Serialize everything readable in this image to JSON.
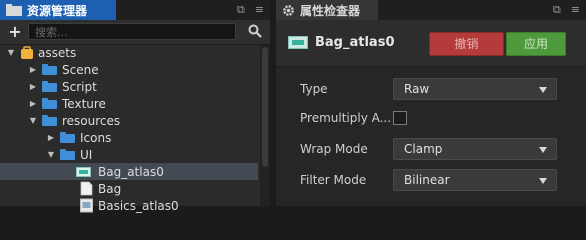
{
  "left_panel": {
    "title": "资源管理器",
    "search": {
      "placeholder": "搜索..."
    },
    "tree": [
      {
        "label": "assets",
        "level": 0,
        "expanded": true,
        "kind": "root"
      },
      {
        "label": "Scene",
        "level": 1,
        "expanded": false,
        "kind": "folder"
      },
      {
        "label": "Script",
        "level": 1,
        "expanded": false,
        "kind": "folder"
      },
      {
        "label": "Texture",
        "level": 1,
        "expanded": false,
        "kind": "folder"
      },
      {
        "label": "resources",
        "level": 1,
        "expanded": true,
        "kind": "folder"
      },
      {
        "label": "Icons",
        "level": 2,
        "expanded": false,
        "kind": "folder"
      },
      {
        "label": "UI",
        "level": 2,
        "expanded": true,
        "kind": "folder"
      },
      {
        "label": "Bag_atlas0",
        "level": 3,
        "kind": "atlas",
        "selected": true
      },
      {
        "label": "Bag",
        "level": 3,
        "kind": "file"
      },
      {
        "label": "Basics_atlas0",
        "level": 3,
        "kind": "atlas"
      }
    ]
  },
  "right_panel": {
    "title": "属性检查器",
    "asset_name": "Bag_atlas0",
    "revert_label": "撤销",
    "apply_label": "应用",
    "properties": [
      {
        "label": "Type",
        "type": "dropdown",
        "value": "Raw"
      },
      {
        "label": "Premultiply A...",
        "type": "checkbox",
        "checked": false
      },
      {
        "label": "Wrap Mode",
        "type": "dropdown",
        "value": "Clamp"
      },
      {
        "label": "Filter Mode",
        "type": "dropdown",
        "value": "Bilinear"
      }
    ]
  },
  "colors": {
    "active_tab": "#1d5fb0",
    "folder": "#3f8ed8",
    "revert": "#b53a3a",
    "apply": "#4c9a3c",
    "selected_row": "#434a54"
  }
}
